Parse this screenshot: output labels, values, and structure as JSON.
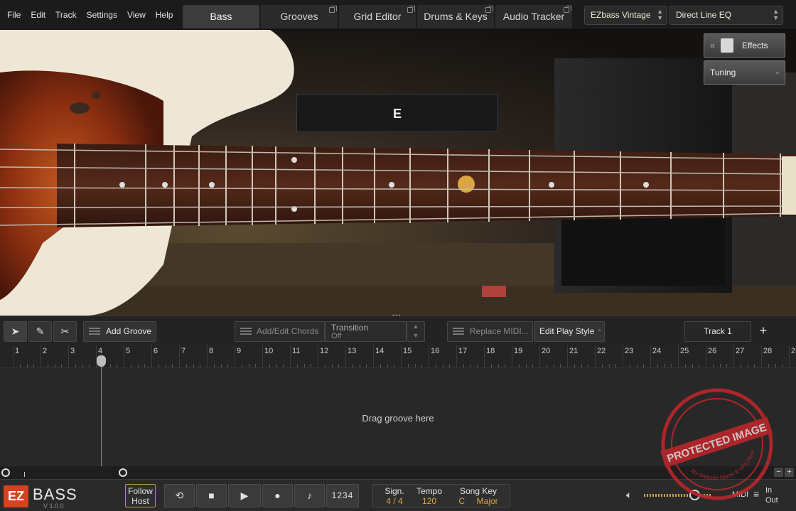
{
  "menu": [
    "File",
    "Edit",
    "Track",
    "Settings",
    "View",
    "Help"
  ],
  "tabs": [
    {
      "label": "Bass",
      "active": true
    },
    {
      "label": "Grooves"
    },
    {
      "label": "Grid Editor"
    },
    {
      "label": "Drums & Keys"
    },
    {
      "label": "Audio Tracker"
    }
  ],
  "preset": "EZbass Vintage",
  "eq_preset": "Direct Line EQ",
  "note_display": "E",
  "side_buttons": {
    "effects": "Effects",
    "tuning": "Tuning"
  },
  "toolbar": {
    "add_groove": "Add Groove",
    "add_chords": "Add/Edit Chords",
    "transition_label": "Transition",
    "transition_value": "Off",
    "replace_midi": "Replace MIDI...",
    "edit_play_style": "Edit Play Style",
    "track_name": "Track 1",
    "add_track": "+"
  },
  "ruler": [
    "1",
    "2",
    "3",
    "4",
    "5",
    "6",
    "7",
    "8",
    "9",
    "10",
    "11",
    "12",
    "13",
    "14",
    "15",
    "16",
    "17",
    "18",
    "19",
    "20",
    "21",
    "22",
    "23",
    "24",
    "25",
    "26",
    "27",
    "28",
    "2"
  ],
  "playhead_bar": 4,
  "drop_hint": "Drag groove here",
  "zoom": {
    "out": "−",
    "in": "+"
  },
  "transport": {
    "logo": "EZ",
    "brand": "BASS",
    "version": "V 1.0.0",
    "follow_host": "Follow\nHost",
    "count_in": "1234",
    "signature_label": "Sign.",
    "signature_value": "4 / 4",
    "tempo_label": "Tempo",
    "tempo_value": "120",
    "song_key_label": "Song Key",
    "key_root": "C",
    "key_mode": "Major",
    "midi": "MIDI",
    "io_in": "In",
    "io_out": "Out"
  },
  "watermark": {
    "main": "PROTECTED IMAGE",
    "sub": "My Website Name & URL Here"
  },
  "colors": {
    "accent_gold": "#d9a640",
    "logo_orange": "#d6431f"
  }
}
